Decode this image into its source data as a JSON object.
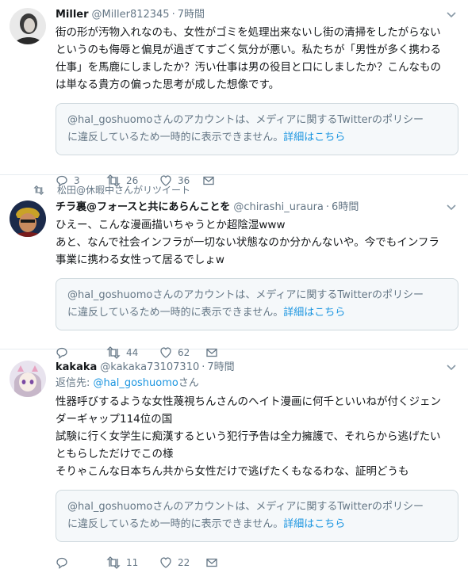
{
  "tweets": [
    {
      "retweeted_by": null,
      "name": "Miller",
      "handle": "@Miller812345",
      "dot": "·",
      "time": "7時間",
      "reply_to": null,
      "lines": [
        "街の形が汚物入れなのも、女性がゴミを処理出来ないし街の清掃をしたがらない",
        "というのも侮辱と偏見が過ぎてすごく気分が悪い。私たちが「男性が多く携わる",
        "仕事」を馬鹿にしましたか？汚い仕事は男の役目と口にしましたか？こんなもの",
        "は単なる貴方の偏った思考が成した想像です。"
      ],
      "notice_line1": "@hal_goshuomoさんのアカウントは、メディアに関するTwitterのポリシー",
      "notice_line2": "に違反しているため一時的に表示できません。",
      "notice_link": "詳細はこちら",
      "replies": "3",
      "retweets": "26",
      "likes": "36"
    },
    {
      "retweeted_by": "松田@休暇中さんがリツイート",
      "name": "チラ裏@フォースと共にあらんことを",
      "handle": "@chirashi_uraura",
      "dot": "·",
      "time": "6時間",
      "reply_to": null,
      "lines": [
        "ひえー、こんな漫画描いちゃうとか超陰湿www",
        "あと、なんで社会インフラが一切ない状態なのか分かんないや。今でもインフラ",
        "事業に携わる女性って居るでしょw"
      ],
      "notice_line1": "@hal_goshuomoさんのアカウントは、メディアに関するTwitterのポリシー",
      "notice_line2": "に違反しているため一時的に表示できません。",
      "notice_link": "詳細はこちら",
      "replies": "",
      "retweets": "44",
      "likes": "62"
    },
    {
      "retweeted_by": null,
      "name": "kakaka",
      "handle": "@kakaka73107310",
      "dot": "·",
      "time": "7時間",
      "reply_to": {
        "prefix": "返信先: ",
        "mention": "@hal_goshuomo",
        "suffix": "さん"
      },
      "lines": [
        "性器呼びするような女性蔑視ちんさんのヘイト漫画に何千といいねが付くジェン",
        "ダーギャップ114位の国",
        "試験に行く女学生に痴漢するという犯行予告は全力擁護で、それらから逃げたい",
        "ともらしただけでこの様",
        "そりゃこんな日本ちん共から女性だけで逃げたくもなるわな、証明どうも"
      ],
      "notice_line1": "@hal_goshuomoさんのアカウントは、メディアに関するTwitterのポリシー",
      "notice_line2": "に違反しているため一時的に表示できません。",
      "notice_link": "詳細はこちら",
      "replies": "",
      "retweets": "11",
      "likes": "22"
    }
  ],
  "icons": [
    "reply-icon",
    "retweet-icon",
    "heart-icon",
    "message-icon",
    "chevron-down-icon"
  ],
  "colors": {
    "text": "#14171a",
    "secondary": "#657786",
    "link": "#1b95e0",
    "border": "#e6ecf0",
    "notice_bg": "#f5f8fa"
  }
}
